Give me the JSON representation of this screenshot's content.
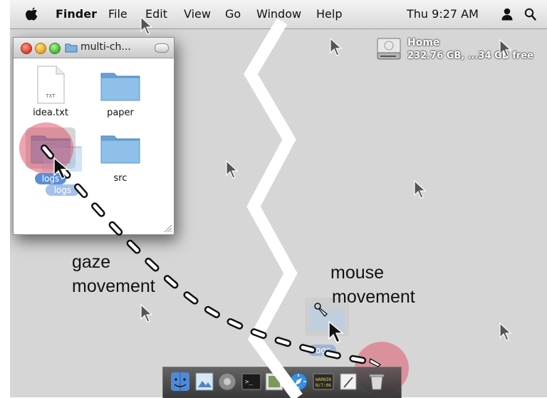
{
  "menubar": {
    "app_name": "Finder",
    "items": [
      "File",
      "Edit",
      "View",
      "Go",
      "Window",
      "Help"
    ],
    "clock": "Thu 9:27 AM"
  },
  "desktop": {
    "disk": {
      "name": "Home",
      "info": "232.76 GB, ...34 GB free"
    }
  },
  "finder_window": {
    "title": "multi-ch...",
    "files": [
      {
        "name": "idea.txt",
        "icon": "text-file-icon",
        "badge": "TXT"
      },
      {
        "name": "paper",
        "icon": "folder-icon"
      },
      {
        "name": "logs",
        "icon": "folder-icon",
        "state": "selected"
      },
      {
        "name": "src",
        "icon": "folder-icon"
      }
    ],
    "drag_labels": [
      "logs",
      "logs"
    ]
  },
  "annotations": {
    "gaze_line1": "gaze",
    "gaze_line2": "movement",
    "mouse_line1": "mouse",
    "mouse_line2": "movement"
  },
  "dock": {
    "items": [
      "finder-icon",
      "preview-icon",
      "system-prefs-icon",
      "terminal-icon",
      "photo-icon",
      "safari-icon",
      "console-icon",
      "textedit-icon",
      "trash-icon"
    ],
    "console_text": [
      "WARNIN",
      "N/7:06"
    ]
  },
  "colors": {
    "desktop": "#d6d6d6",
    "folder_blue": "#7fb3df",
    "selection_blue": "#5a8fd8",
    "gaze_highlight": "#e06a7a",
    "divider": "#ffffff"
  }
}
